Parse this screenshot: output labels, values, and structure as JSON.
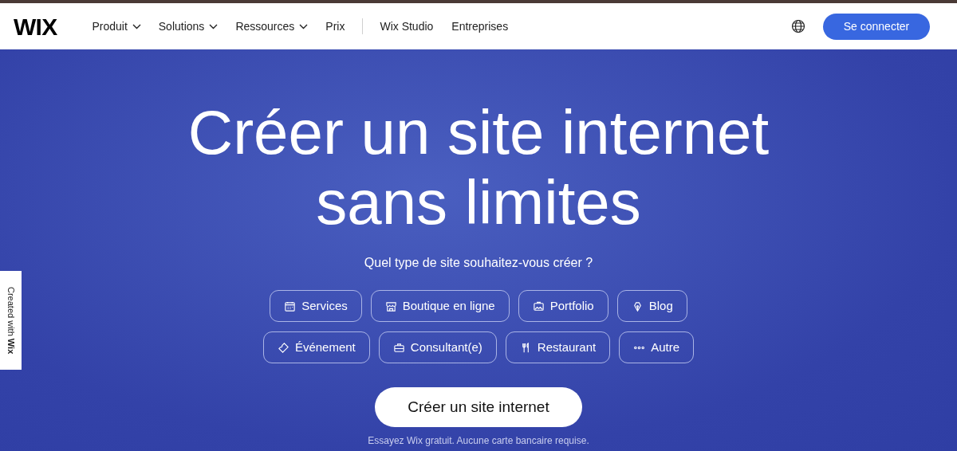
{
  "header": {
    "logo": "WIX",
    "nav": [
      {
        "label": "Produit",
        "has_dropdown": true
      },
      {
        "label": "Solutions",
        "has_dropdown": true
      },
      {
        "label": "Ressources",
        "has_dropdown": true
      },
      {
        "label": "Prix",
        "has_dropdown": false
      }
    ],
    "nav_secondary": [
      "Wix Studio",
      "Entreprises"
    ],
    "login_button": "Se connecter"
  },
  "hero": {
    "title_lines": [
      "Créer un site internet",
      "sans limites"
    ],
    "question": "Quel type de site souhaitez-vous créer ?",
    "category_rows": [
      [
        {
          "label": "Services",
          "kind": "calendar"
        },
        {
          "label": "Boutique en ligne",
          "kind": "store"
        },
        {
          "label": "Portfolio",
          "kind": "image"
        },
        {
          "label": "Blog",
          "kind": "pen"
        }
      ],
      [
        {
          "label": "Événement",
          "kind": "ticket"
        },
        {
          "label": "Consultant(e)",
          "kind": "briefcase"
        },
        {
          "label": "Restaurant",
          "kind": "cutlery"
        },
        {
          "label": "Autre",
          "kind": "dots"
        }
      ]
    ],
    "cta_button": "Créer un site internet",
    "note": "Essayez Wix gratuit. Aucune carte bancaire requise."
  },
  "side_tab": "Created with **Wix**"
}
